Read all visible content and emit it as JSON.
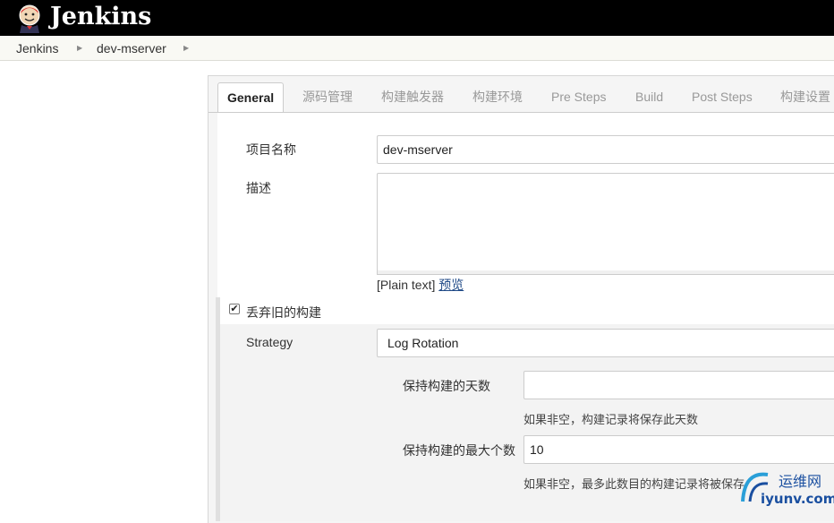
{
  "header": {
    "brand": "Jenkins",
    "logo_icon": "jenkins-butler-icon"
  },
  "breadcrumb": {
    "items": [
      "Jenkins",
      "dev-mserver"
    ]
  },
  "tabs": [
    "General",
    "源码管理",
    "构建触发器",
    "构建环境",
    "Pre Steps",
    "Build",
    "Post Steps",
    "构建设置"
  ],
  "form": {
    "project_name_label": "项目名称",
    "project_name_value": "dev-mserver",
    "description_label": "描述",
    "description_value": "",
    "plain_text": "[Plain text]",
    "preview_link": "预览",
    "discard_old_label": "丢弃旧的构建",
    "discard_old_checked": true,
    "strategy_label": "Strategy",
    "strategy_value": "Log Rotation",
    "days_label": "保持构建的天数",
    "days_value": "",
    "days_help": "如果非空，构建记录将保存此天数",
    "max_label": "保持构建的最大个数",
    "max_value": "10",
    "max_help": "如果非空，最多此数目的构建记录将被保存"
  },
  "watermark": {
    "cn": "运维网",
    "en": "iyunv.com"
  }
}
